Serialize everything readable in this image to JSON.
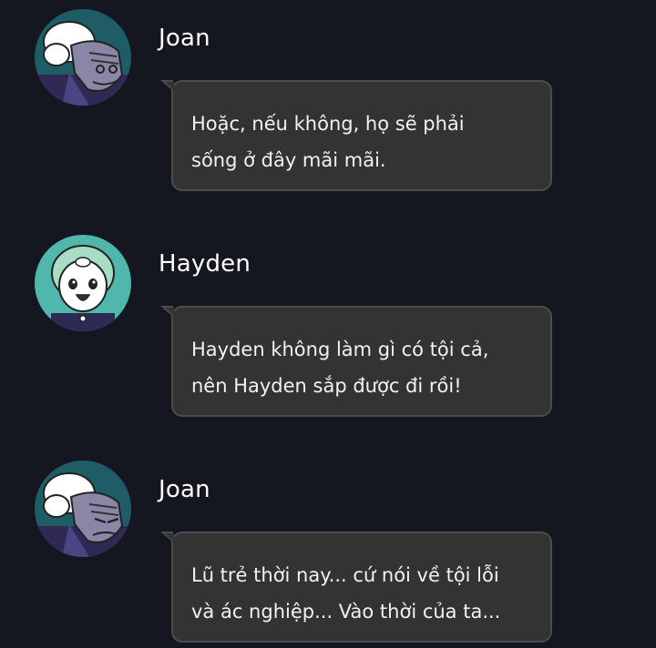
{
  "messages": [
    {
      "speaker": "Joan",
      "avatar_icon": "joan-avatar-icon",
      "lines": [
        "Hoặc, nếu không, họ sẽ phải",
        "sống ở đây mãi mãi."
      ]
    },
    {
      "speaker": "Hayden",
      "avatar_icon": "hayden-avatar-icon",
      "lines": [
        "Hayden không làm gì có tội cả,",
        "nên Hayden sắp được đi rồi!"
      ]
    },
    {
      "speaker": "Joan",
      "avatar_icon": "joan-avatar-icon",
      "lines": [
        "Lũ trẻ thời nay... cứ nói về tội lỗi",
        "và ác nghiệp... Vào thời của ta..."
      ]
    }
  ],
  "colors": {
    "background": "#141620",
    "bubble_fill": "#333333",
    "bubble_border": "#4c4c4c",
    "joan_avatar_bg": "#1e5d66",
    "hayden_avatar_bg": "#4fb7ac"
  }
}
